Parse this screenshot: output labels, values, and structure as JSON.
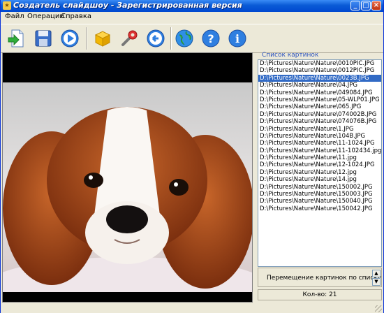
{
  "window": {
    "title": "Создатель слайдшоу - Зарегистрированная версия"
  },
  "menu": [
    "Файл",
    "Операции",
    "Справка"
  ],
  "toolbar": {
    "buttons": [
      "import-icon",
      "save-icon",
      "play-icon",
      "package-icon",
      "tools-icon",
      "back-icon",
      "globe-icon",
      "help-icon",
      "info-icon"
    ]
  },
  "list": {
    "caption": "Список картинок",
    "items": [
      "D:\\Pictures\\Nature\\Nature\\0010PIC.JPG",
      "D:\\Pictures\\Nature\\Nature\\0012PIC.JPG",
      "D:\\Pictures\\Nature\\Nature\\0023B.JPG",
      "D:\\Pictures\\Nature\\Nature\\04.JPG",
      "D:\\Pictures\\Nature\\Nature\\049084.JPG",
      "D:\\Pictures\\Nature\\Nature\\05-WLP01.JPG",
      "D:\\Pictures\\Nature\\Nature\\065.JPG",
      "D:\\Pictures\\Nature\\Nature\\074002B.JPG",
      "D:\\Pictures\\Nature\\Nature\\074076B.JPG",
      "D:\\Pictures\\Nature\\Nature\\1.JPG",
      "D:\\Pictures\\Nature\\Nature\\104B.JPG",
      "D:\\Pictures\\Nature\\Nature\\11-1024.JPG",
      "D:\\Pictures\\Nature\\Nature\\11-102434.jpg",
      "D:\\Pictures\\Nature\\Nature\\11.jpg",
      "D:\\Pictures\\Nature\\Nature\\12-1024.JPG",
      "D:\\Pictures\\Nature\\Nature\\12.jpg",
      "D:\\Pictures\\Nature\\Nature\\14.jpg",
      "D:\\Pictures\\Nature\\Nature\\150002.JPG",
      "D:\\Pictures\\Nature\\Nature\\150003.JPG",
      "D:\\Pictures\\Nature\\Nature\\150040.JPG",
      "D:\\Pictures\\Nature\\Nature\\150042.JPG"
    ],
    "selected_index": 2
  },
  "order": {
    "label": "Перемещение картинок по списку",
    "up": "▲",
    "down": "▼"
  },
  "count": {
    "text": "Кол-во: 21"
  },
  "colors": {
    "titlebar": "#0A5BD6",
    "selection": "#316AC5",
    "caption": "#2A52BE"
  }
}
